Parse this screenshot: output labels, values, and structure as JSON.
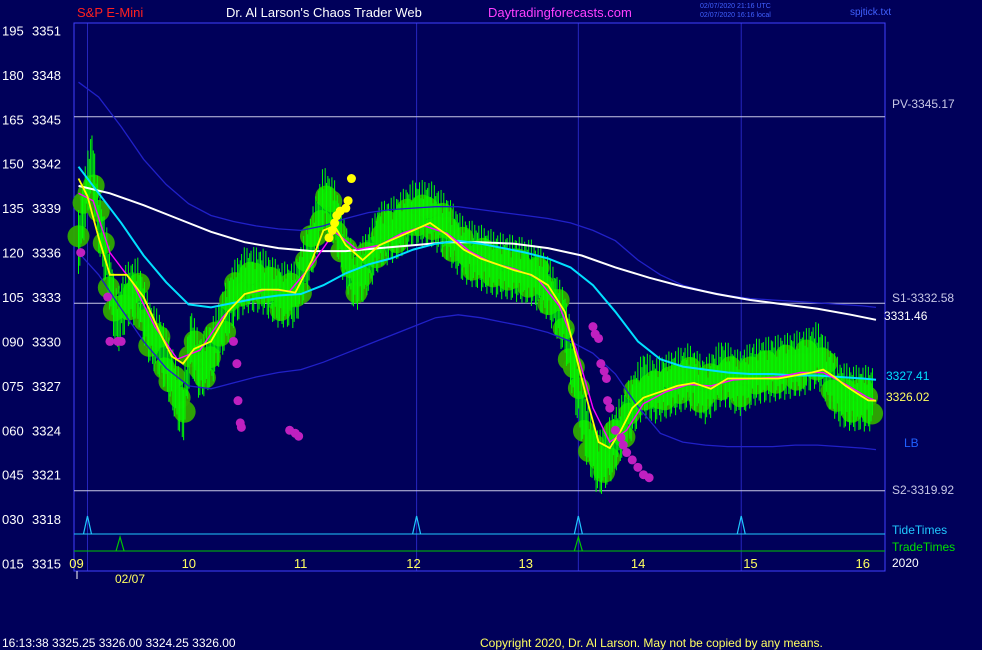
{
  "header": {
    "symbol": "S&P E-Mini",
    "title": "Dr. Al Larson's Chaos Trader Web",
    "site": "Daytradingforecasts.com",
    "utc_stamp": "02/07/2020 21:16 UTC",
    "local_stamp": "02/07/2020 16:16 local",
    "file_tag": "spjtick.txt"
  },
  "footer": {
    "status_line": "16:13:38  3325.25 3326.00 3324.25 3326.00",
    "copyright": "Copyright 2020, Dr. Al Larson. May not be copied by any means."
  },
  "colors": {
    "background": "#00005a",
    "frame": "#4040ff",
    "price": "#00ff00",
    "bubble": "#2faa00",
    "emaA": "#ffff00",
    "emaB": "#ff00ff",
    "ma100": "#00e0ff",
    "ma200": "#ffffff",
    "envelope": "#2020c8",
    "level": "#c8c8e6",
    "tide": "#20c8ff",
    "trade": "#00c800",
    "low_dot": "#c020c0",
    "high_dot": "#ffff00"
  },
  "chart_data": {
    "type": "line",
    "xlim": [
      8.98,
      16.2
    ],
    "ylim": [
      3314.5,
      3351.5
    ],
    "x_ticks": [
      "09",
      "10",
      "11",
      "12",
      "13",
      "14",
      "15",
      "16"
    ],
    "x_tick_values": [
      9,
      10,
      11,
      12,
      13,
      14,
      15,
      16
    ],
    "date_label": "02/07",
    "year_label": "2020",
    "y_ticks": [
      {
        "idx": "195",
        "price": "3351",
        "v": 3351
      },
      {
        "idx": "180",
        "price": "3348",
        "v": 3348
      },
      {
        "idx": "165",
        "price": "3345",
        "v": 3345
      },
      {
        "idx": "150",
        "price": "3342",
        "v": 3342
      },
      {
        "idx": "135",
        "price": "3339",
        "v": 3339
      },
      {
        "idx": "120",
        "price": "3336",
        "v": 3336
      },
      {
        "idx": "105",
        "price": "3333",
        "v": 3333
      },
      {
        "idx": "090",
        "price": "3330",
        "v": 3330
      },
      {
        "idx": "075",
        "price": "3327",
        "v": 3327
      },
      {
        "idx": "060",
        "price": "3324",
        "v": 3324
      },
      {
        "idx": "045",
        "price": "3321",
        "v": 3321
      },
      {
        "idx": "030",
        "price": "3318",
        "v": 3318
      },
      {
        "idx": "015",
        "price": "3315",
        "v": 3315
      }
    ],
    "levels": [
      {
        "name": "PV-3345.17",
        "v": 3345.17
      },
      {
        "name": "S1-3332.58",
        "v": 3332.58
      },
      {
        "name": "S2-3319.92",
        "v": 3319.92
      }
    ],
    "end_labels": {
      "ma200": "3331.46",
      "ma100": "3327.41",
      "price": "3326.02",
      "lb": "LB"
    },
    "vgrid_x": [
      9.1,
      12.03,
      13.47,
      14.92
    ],
    "price_series": {
      "x": [
        9.02,
        9.08,
        9.14,
        9.2,
        9.28,
        9.36,
        9.45,
        9.55,
        9.65,
        9.75,
        9.85,
        9.95,
        10.02,
        10.1,
        10.2,
        10.3,
        10.4,
        10.5,
        10.65,
        10.8,
        10.95,
        11.1,
        11.2,
        11.3,
        11.38,
        11.48,
        11.58,
        11.7,
        11.85,
        12.0,
        12.15,
        12.3,
        12.45,
        12.6,
        12.75,
        12.9,
        13.05,
        13.2,
        13.35,
        13.45,
        13.55,
        13.65,
        13.75,
        13.85,
        13.95,
        14.05,
        14.15,
        14.3,
        14.45,
        14.6,
        14.75,
        14.9,
        15.05,
        15.2,
        15.35,
        15.5,
        15.6,
        15.7,
        15.8,
        15.9,
        16.0,
        16.1
      ],
      "y": [
        3336.5,
        3339.5,
        3342,
        3338,
        3335,
        3331,
        3333,
        3333.3,
        3330.5,
        3329.5,
        3327.5,
        3325,
        3330,
        3328,
        3329,
        3331,
        3333,
        3334,
        3334,
        3333,
        3333,
        3336.5,
        3339.5,
        3338.5,
        3336,
        3334,
        3335,
        3337,
        3337.5,
        3338.5,
        3338.5,
        3337.5,
        3336,
        3335.5,
        3335,
        3334.8,
        3334.5,
        3333.5,
        3331,
        3327,
        3323.5,
        3321.5,
        3322.5,
        3324,
        3325.5,
        3327,
        3326.5,
        3327,
        3327.5,
        3326.5,
        3327.8,
        3327,
        3327.8,
        3328,
        3328.2,
        3328.5,
        3329,
        3327.5,
        3326.3,
        3326.02,
        3326,
        3326.02
      ]
    },
    "emaA_series": {
      "x": [
        9.02,
        9.1,
        9.2,
        9.3,
        9.45,
        9.6,
        9.75,
        9.85,
        9.95,
        10.05,
        10.2,
        10.35,
        10.5,
        10.65,
        10.8,
        10.95,
        11.1,
        11.2,
        11.3,
        11.4,
        11.55,
        11.7,
        11.85,
        12.0,
        12.15,
        12.3,
        12.45,
        12.6,
        12.75,
        12.9,
        13.05,
        13.2,
        13.35,
        13.45,
        13.55,
        13.65,
        13.75,
        13.85,
        13.95,
        14.05,
        14.2,
        14.35,
        14.5,
        14.65,
        14.8,
        14.95,
        15.1,
        15.25,
        15.4,
        15.55,
        15.65,
        15.75,
        15.85,
        15.95,
        16.05,
        16.12
      ],
      "y": [
        3341,
        3339.8,
        3337,
        3334.5,
        3334.5,
        3333,
        3330.5,
        3329,
        3328.5,
        3329.5,
        3330,
        3332,
        3333.2,
        3333.5,
        3333.5,
        3333.3,
        3335.5,
        3337.5,
        3337.8,
        3336.5,
        3335.5,
        3336.5,
        3337,
        3337.5,
        3338,
        3337.2,
        3336.2,
        3335.6,
        3335.2,
        3334.8,
        3334.5,
        3333.8,
        3332,
        3329,
        3326,
        3323.2,
        3322.8,
        3324,
        3325.5,
        3326.2,
        3326.6,
        3327,
        3327.2,
        3326.8,
        3327.5,
        3327.5,
        3327.5,
        3327.5,
        3327.7,
        3327.9,
        3328.1,
        3327.6,
        3327,
        3326.5,
        3326.02,
        3326
      ]
    },
    "emaB_series": {
      "x": [
        9.02,
        9.15,
        9.3,
        9.5,
        9.7,
        9.9,
        10.1,
        10.3,
        10.5,
        10.7,
        10.9,
        11.1,
        11.3,
        11.5,
        11.7,
        11.9,
        12.1,
        12.3,
        12.5,
        12.7,
        12.9,
        13.1,
        13.3,
        13.45,
        13.6,
        13.75,
        13.9,
        14.05,
        14.25,
        14.45,
        14.65,
        14.85,
        15.05,
        15.25,
        15.45,
        15.65,
        15.85,
        16.05,
        16.12
      ],
      "y": [
        3340,
        3339.5,
        3336,
        3334,
        3331,
        3328.8,
        3329.4,
        3331.6,
        3333.2,
        3333.5,
        3333.4,
        3335.2,
        3337.4,
        3336.2,
        3336.5,
        3337.3,
        3337.8,
        3337.3,
        3336.1,
        3335.3,
        3334.9,
        3334.3,
        3332.4,
        3329.5,
        3325.5,
        3323.2,
        3324,
        3325.8,
        3326.6,
        3327.1,
        3327,
        3327.4,
        3327.5,
        3327.6,
        3327.9,
        3327.9,
        3327.1,
        3326.2,
        3326
      ]
    },
    "ma100_series": {
      "x": [
        9.02,
        9.2,
        9.4,
        9.6,
        9.8,
        10.0,
        10.2,
        10.4,
        10.6,
        10.8,
        11.0,
        11.2,
        11.4,
        11.6,
        11.8,
        12.0,
        12.2,
        12.4,
        12.6,
        12.8,
        13.0,
        13.2,
        13.4,
        13.6,
        13.8,
        14.0,
        14.2,
        14.4,
        14.6,
        14.8,
        15.0,
        15.2,
        15.4,
        15.6,
        15.8,
        16.0,
        16.12
      ],
      "y": [
        3341.8,
        3340,
        3338,
        3335.8,
        3334,
        3332.5,
        3332.3,
        3332.6,
        3332.9,
        3333.1,
        3333.2,
        3333.8,
        3334.6,
        3335.2,
        3335.6,
        3336.2,
        3336.6,
        3336.8,
        3336.6,
        3336.3,
        3336,
        3335.6,
        3335,
        3333.8,
        3332,
        3330,
        3328.8,
        3328.3,
        3328.1,
        3327.9,
        3327.8,
        3327.8,
        3327.7,
        3327.7,
        3327.6,
        3327.5,
        3327.41
      ]
    },
    "ma200_series": {
      "x": [
        9.02,
        9.3,
        9.6,
        9.9,
        10.2,
        10.5,
        10.8,
        11.1,
        11.4,
        11.7,
        12.0,
        12.3,
        12.6,
        12.9,
        13.2,
        13.5,
        13.8,
        14.1,
        14.4,
        14.7,
        15.0,
        15.3,
        15.6,
        15.9,
        16.12
      ],
      "y": [
        3340.5,
        3340,
        3339.2,
        3338.3,
        3337.4,
        3336.7,
        3336.3,
        3336.1,
        3336.1,
        3336.3,
        3336.5,
        3336.7,
        3336.7,
        3336.6,
        3336.3,
        3335.8,
        3335,
        3334.3,
        3333.7,
        3333.2,
        3332.8,
        3332.5,
        3332.2,
        3331.8,
        3331.46
      ]
    },
    "envelope_upper": {
      "x": [
        9.02,
        9.2,
        9.4,
        9.6,
        9.8,
        10.0,
        10.2,
        10.4,
        10.6,
        10.8,
        11.0,
        11.2,
        11.4,
        11.6,
        11.8,
        12.0,
        12.2,
        12.4,
        12.6,
        12.8,
        13.0,
        13.2,
        13.4,
        13.6,
        13.8,
        14.0,
        14.2,
        14.4,
        14.6,
        14.8,
        15.0,
        15.2,
        15.4,
        15.6,
        15.8,
        16.0,
        16.12
      ],
      "y": [
        3347.5,
        3346.5,
        3344.5,
        3342.3,
        3340.6,
        3339.3,
        3338.5,
        3338.1,
        3337.8,
        3337.6,
        3337.5,
        3337.8,
        3338.3,
        3338.7,
        3338.9,
        3339,
        3339.1,
        3339.1,
        3338.9,
        3338.7,
        3338.5,
        3338.3,
        3338,
        3337.5,
        3336.8,
        3335.5,
        3334.5,
        3333.8,
        3333.4,
        3333.1,
        3332.9,
        3332.8,
        3332.7,
        3332.6,
        3332.5,
        3332.4,
        3332.3
      ]
    },
    "envelope_lower": {
      "x": [
        9.02,
        9.2,
        9.4,
        9.6,
        9.8,
        10.0,
        10.2,
        10.4,
        10.6,
        10.8,
        11.0,
        11.2,
        11.4,
        11.6,
        11.8,
        12.0,
        12.2,
        12.4,
        12.6,
        12.8,
        13.0,
        13.2,
        13.4,
        13.6,
        13.8,
        14.0,
        14.2,
        14.4,
        14.6,
        14.8,
        15.0,
        15.2,
        15.4,
        15.6,
        15.8,
        16.0,
        16.12
      ],
      "y": [
        3336,
        3334.5,
        3332.2,
        3330,
        3328.2,
        3327,
        3326.8,
        3327.2,
        3327.6,
        3327.9,
        3328.1,
        3328.6,
        3329.2,
        3329.8,
        3330.4,
        3331,
        3331.6,
        3331.8,
        3331.6,
        3331.3,
        3331,
        3330.6,
        3330,
        3329.2,
        3327.8,
        3325.6,
        3323.8,
        3323.2,
        3323,
        3322.9,
        3322.9,
        3322.9,
        3323,
        3323,
        3322.9,
        3322.8,
        3322.7
      ]
    },
    "low_dots": {
      "x": [
        9.04,
        9.28,
        9.3,
        9.37,
        9.4,
        10.4,
        10.43,
        10.44,
        10.46,
        10.47,
        10.9,
        10.95,
        10.98,
        13.6,
        13.62,
        13.65,
        13.67,
        13.7,
        13.72,
        13.73,
        13.75,
        13.8,
        13.85,
        13.87,
        13.9,
        13.95,
        14.0,
        14.05,
        14.1
      ],
      "y": [
        3336,
        3333,
        3330,
        3330,
        3330,
        3330,
        3328.5,
        3326,
        3324.5,
        3324.2,
        3324,
        3323.8,
        3323.6,
        3331,
        3330.5,
        3330.2,
        3328.5,
        3328,
        3327.5,
        3326,
        3325.5,
        3324,
        3323.5,
        3323,
        3322.5,
        3322,
        3321.5,
        3321,
        3320.8
      ]
    },
    "high_dots": {
      "x": [
        11.25,
        11.28,
        11.3,
        11.32,
        11.35,
        11.4,
        11.42,
        11.45
      ],
      "y": [
        3337,
        3337.5,
        3338,
        3338.5,
        3338.8,
        3339,
        3339.5,
        3341
      ]
    },
    "tide_times": [
      9.1,
      12.03,
      13.47,
      14.92
    ],
    "trade_times": [
      9.39,
      13.47
    ]
  },
  "series_labels": {
    "tide": "TideTimes",
    "trade": "TradeTimes"
  }
}
